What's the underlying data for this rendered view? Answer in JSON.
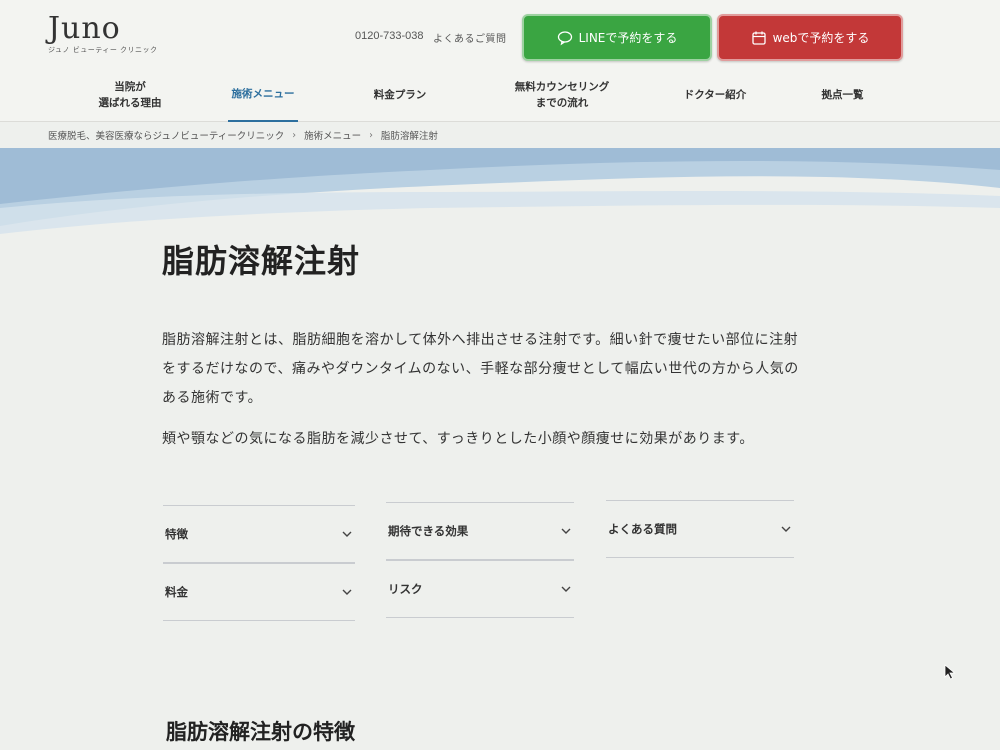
{
  "header": {
    "logo_text": "Juno",
    "logo_sub": "ジュノ ビューティー クリニック",
    "phone": "0120-733-038",
    "faq_link": "よくあるご質問",
    "line_button": "LINEで予約をする",
    "web_button": "webで予約をする"
  },
  "nav": {
    "items": [
      {
        "label": "当院が\n選ばれる理由"
      },
      {
        "label": "施術メニュー"
      },
      {
        "label": "料金プラン"
      },
      {
        "label": "無料カウンセリング\nまでの流れ"
      },
      {
        "label": "ドクター紹介"
      },
      {
        "label": "拠点一覧"
      }
    ],
    "active_index": 1
  },
  "breadcrumb": {
    "items": [
      "医療脱毛、美容医療ならジュノビューティークリニック",
      "施術メニュー",
      "脂肪溶解注射"
    ],
    "separator": "›"
  },
  "main": {
    "title": "脂肪溶解注射",
    "intro": "脂肪溶解注射とは、脂肪細胞を溶かして体外へ排出させる注射です。細い針で痩せたい部位に注射をするだけなので、痛みやダウンタイムのない、手軽な部分痩せとして幅広い世代の方から人気のある施術です。",
    "intro2": "頬や顎などの気になる脂肪を減少させて、すっきりとした小顔や顔痩せに効果があります。",
    "accordion": [
      {
        "label": "特徴"
      },
      {
        "label": "期待できる効果"
      },
      {
        "label": "よくある質問"
      },
      {
        "label": "料金"
      },
      {
        "label": "リスク"
      }
    ],
    "section_title": "脂肪溶解注射の特徴"
  },
  "colors": {
    "line_green": "#3aa542",
    "web_red": "#c33838",
    "accent_blue": "#2d6f9e",
    "wave_blue": "#a9c5dc"
  }
}
